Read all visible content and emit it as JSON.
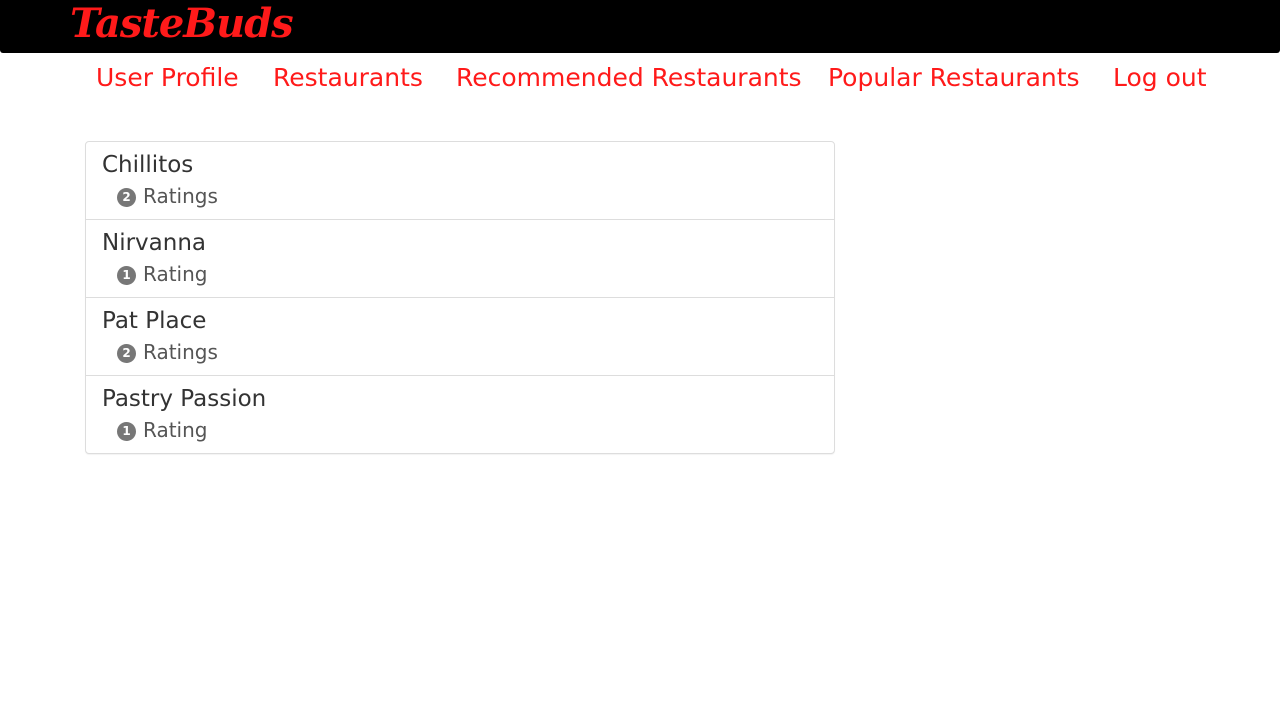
{
  "brand": {
    "name": "TasteBuds",
    "color": "#ff1a1a"
  },
  "nav": {
    "items": [
      {
        "label": "User Profile"
      },
      {
        "label": "Restaurants"
      },
      {
        "label": "Recommended Restaurants"
      },
      {
        "label": "Popular Restaurants"
      },
      {
        "label": "Log out"
      }
    ]
  },
  "restaurants": [
    {
      "name": "Chillitos",
      "count": "2",
      "count_label": "Ratings"
    },
    {
      "name": "Nirvanna",
      "count": "1",
      "count_label": "Rating"
    },
    {
      "name": "Pat Place",
      "count": "2",
      "count_label": "Ratings"
    },
    {
      "name": "Pastry Passion",
      "count": "1",
      "count_label": "Rating"
    }
  ]
}
